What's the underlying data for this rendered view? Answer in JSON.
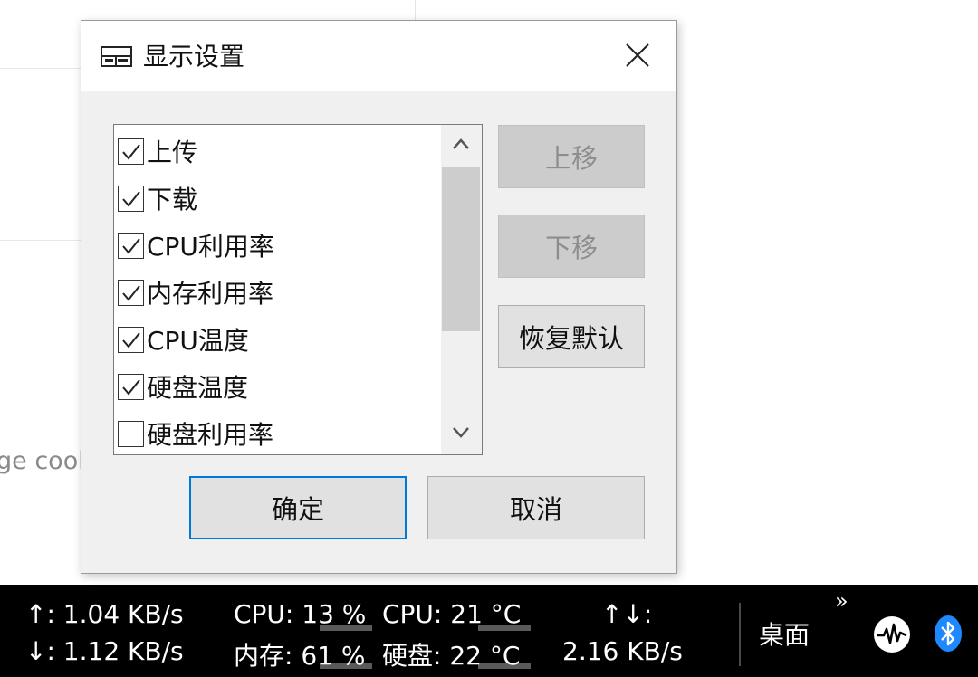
{
  "background": {
    "partial_text": "ge cook"
  },
  "dialog": {
    "title": "显示设置",
    "title_icon": "grid-window-icon",
    "close_icon": "close-icon",
    "list_items": [
      {
        "label": "上传",
        "checked": true
      },
      {
        "label": "下载",
        "checked": true
      },
      {
        "label": "CPU利用率",
        "checked": true
      },
      {
        "label": "内存利用率",
        "checked": true
      },
      {
        "label": "CPU温度",
        "checked": true
      },
      {
        "label": "硬盘温度",
        "checked": true
      },
      {
        "label": "硬盘利用率",
        "checked": false
      }
    ],
    "buttons": {
      "move_up": "上移",
      "move_down": "下移",
      "restore_default": "恢复默认",
      "ok": "确定",
      "cancel": "取消"
    }
  },
  "taskbar": {
    "upload": "↑: 1.04 KB/s",
    "download": "↓: 1.12 KB/s",
    "cpu_usage": "CPU: 13 %",
    "mem_usage": "内存: 61 %",
    "cpu_temp": "CPU: 21 °C",
    "disk_temp": "硬盘: 22 °C",
    "total_label": "↑↓:",
    "total_value": "2.16 KB/s",
    "overflow": "»",
    "desktop": "桌面",
    "tray_icons": [
      "activity-monitor-icon",
      "bluetooth-icon"
    ],
    "bluetooth_color": "#1e88ff"
  }
}
